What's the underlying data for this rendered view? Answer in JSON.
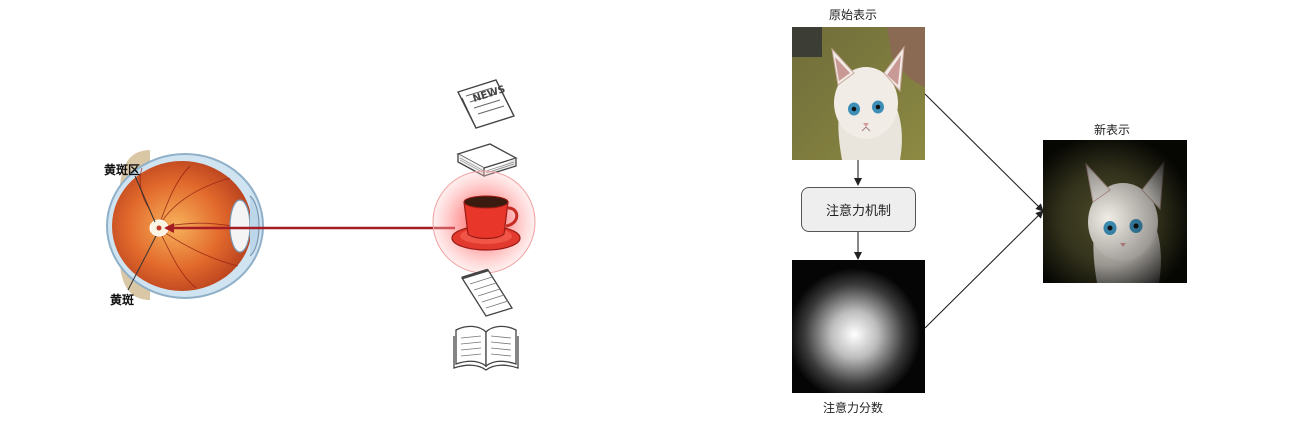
{
  "left_panel": {
    "eye_labels": {
      "macula_region": "黄斑区",
      "macula": "黄斑"
    },
    "objects": [
      "newspaper-icon",
      "book-stack-icon",
      "coffee-cup-icon",
      "notepad-icon",
      "open-book-icon"
    ],
    "focused_object": "coffee-cup-icon",
    "colors": {
      "gaze_arrow": "#a51c24",
      "focus_glow": "#ff5a5a"
    }
  },
  "right_panel": {
    "original_label": "原始表示",
    "mechanism_label": "注意力机制",
    "scores_label": "注意力分数",
    "new_label": "新表示"
  }
}
